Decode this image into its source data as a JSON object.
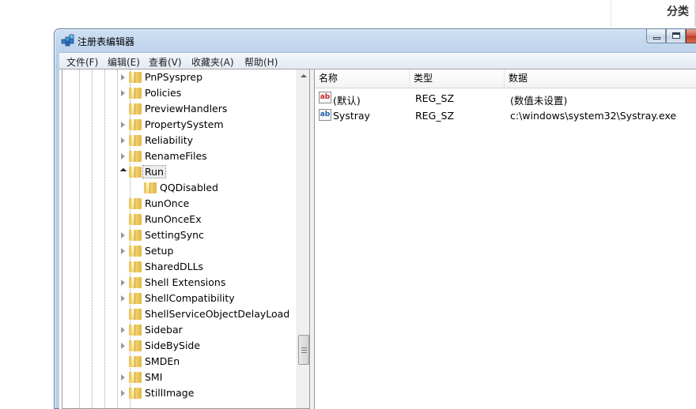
{
  "background": {
    "category_label": "分类"
  },
  "window": {
    "title": "注册表编辑器",
    "icon": "registry-editor-icon",
    "accent_color": "#b8cfe8"
  },
  "menu": {
    "items": [
      "文件(F)",
      "编辑(E)",
      "查看(V)",
      "收藏夹(A)",
      "帮助(H)"
    ]
  },
  "tree": {
    "items": [
      {
        "label": "PnPSysprep",
        "toggle": "collapsed"
      },
      {
        "label": "Policies",
        "toggle": "collapsed"
      },
      {
        "label": "PreviewHandlers",
        "toggle": "none"
      },
      {
        "label": "PropertySystem",
        "toggle": "collapsed"
      },
      {
        "label": "Reliability",
        "toggle": "collapsed"
      },
      {
        "label": "RenameFiles",
        "toggle": "collapsed"
      },
      {
        "label": "Run",
        "toggle": "expanded",
        "selected": true
      },
      {
        "label": "QQDisabled",
        "toggle": "none",
        "child": true
      },
      {
        "label": "RunOnce",
        "toggle": "none"
      },
      {
        "label": "RunOnceEx",
        "toggle": "none"
      },
      {
        "label": "SettingSync",
        "toggle": "collapsed"
      },
      {
        "label": "Setup",
        "toggle": "collapsed"
      },
      {
        "label": "SharedDLLs",
        "toggle": "none"
      },
      {
        "label": "Shell Extensions",
        "toggle": "collapsed"
      },
      {
        "label": "ShellCompatibility",
        "toggle": "collapsed"
      },
      {
        "label": "ShellServiceObjectDelayLoad",
        "toggle": "none"
      },
      {
        "label": "Sidebar",
        "toggle": "collapsed"
      },
      {
        "label": "SideBySide",
        "toggle": "collapsed"
      },
      {
        "label": "SMDEn",
        "toggle": "none"
      },
      {
        "label": "SMI",
        "toggle": "collapsed"
      },
      {
        "label": "StillImage",
        "toggle": "collapsed"
      }
    ]
  },
  "values": {
    "columns": [
      "名称",
      "类型",
      "数据"
    ],
    "rows": [
      {
        "name": "(默认)",
        "type": "REG_SZ",
        "data": "(数值未设置)",
        "icon": "string-value-icon"
      },
      {
        "name": "Systray",
        "type": "REG_SZ",
        "data": "c:\\windows\\system32\\Systray.exe",
        "icon": "string-value-icon"
      }
    ]
  }
}
